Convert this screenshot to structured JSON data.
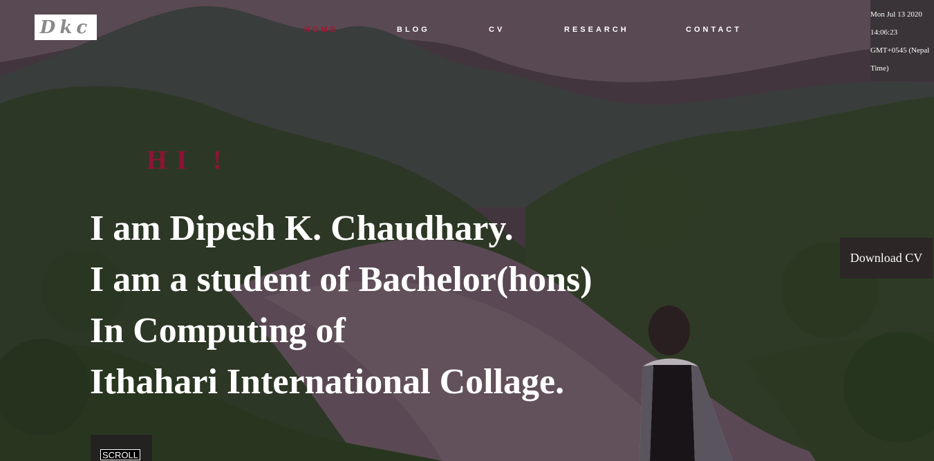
{
  "logo": {
    "text": "Dkc"
  },
  "nav": {
    "items": [
      {
        "label": "HOME",
        "active": true
      },
      {
        "label": "BLOG",
        "active": false
      },
      {
        "label": "CV",
        "active": false
      },
      {
        "label": "RESEARCH",
        "active": false
      },
      {
        "label": "CONTACT",
        "active": false
      }
    ]
  },
  "clock": {
    "line1": "Mon Jul 13 2020",
    "line2": "14:06:23",
    "line3": "GMT+0545 (Nepal",
    "line4": "Time)"
  },
  "hero": {
    "greeting": "HI !",
    "lines": [
      "I am Dipesh K. Chaudhary.",
      "I am a student of Bachelor(hons)",
      "In Computing of",
      "Ithahari International Collage."
    ]
  },
  "download_label": "Download CV",
  "scroll_label": "SCROLL",
  "colors": {
    "accent": "#b0122f",
    "greeting": "#8e1436",
    "text": "#ffffff",
    "clock_bg": "#3a3338"
  }
}
